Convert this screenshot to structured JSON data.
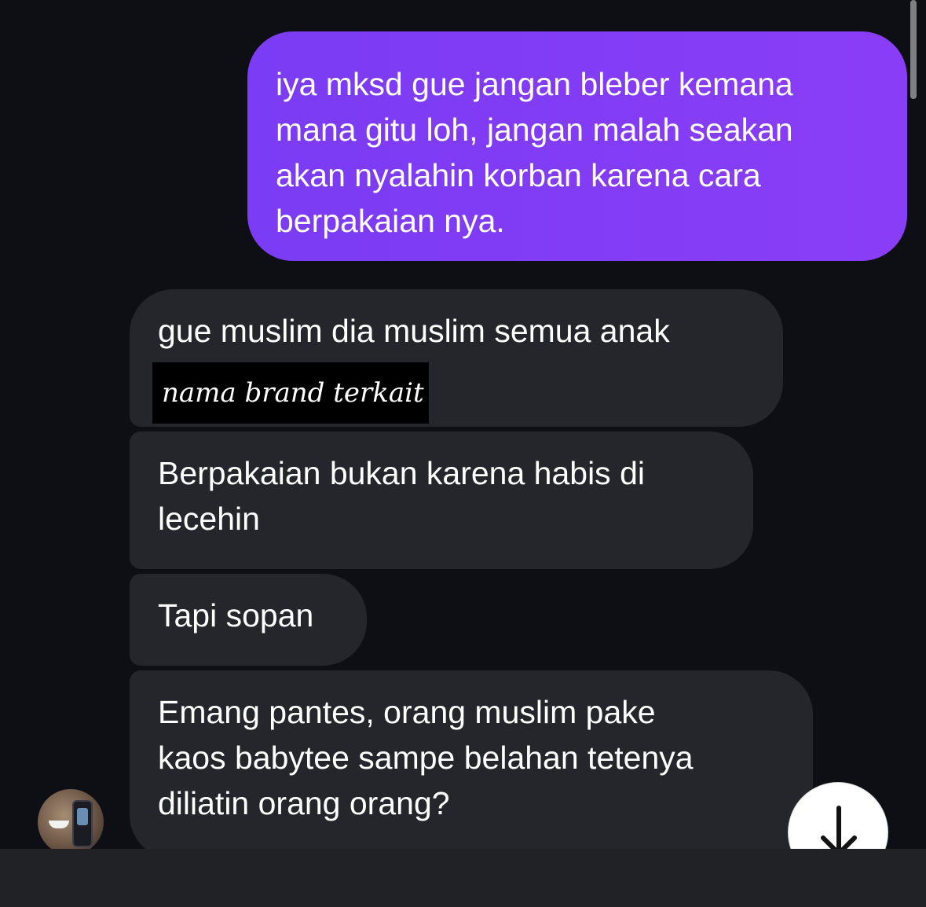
{
  "messages": [
    {
      "direction": "outgoing",
      "text": "iya mksd gue jangan bleber kemana\nmana gitu loh, jangan malah seakan\nakan nyalahin korban karena cara\nberpakaian nya."
    },
    {
      "direction": "incoming",
      "text": "gue muslim dia muslim semua anak\n                             muslim",
      "redaction_label": "nama brand terkait"
    },
    {
      "direction": "incoming",
      "text": "Berpakaian bukan karena habis di\nlecehin"
    },
    {
      "direction": "incoming",
      "text": "Tapi sopan"
    },
    {
      "direction": "incoming",
      "text": "Emang pantes, orang muslim pake\nkaos babytee sampe belahan tetenya\ndiliatin orang orang?"
    }
  ],
  "icons": {
    "scroll_down": "arrow-down-icon",
    "avatar": "user-avatar"
  },
  "colors": {
    "background": "#0e0f14",
    "outgoing_bubble": "#7a3cf4",
    "incoming_bubble": "#25262b",
    "text": "#ffffff",
    "bottom_bar": "#202226"
  }
}
